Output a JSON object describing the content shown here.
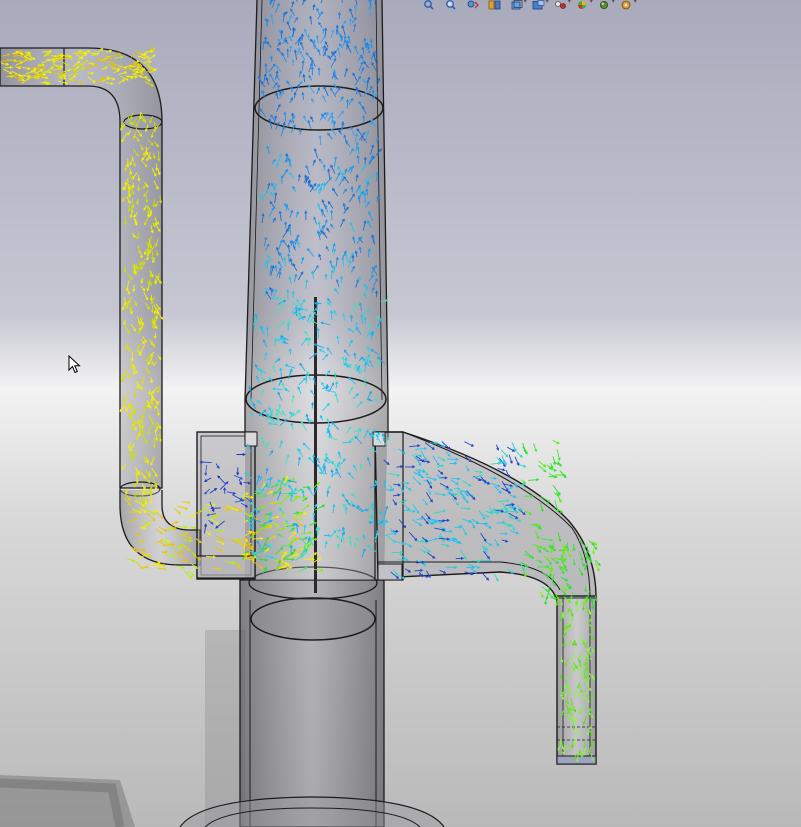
{
  "app": {
    "view": "flow-simulation-viewport"
  },
  "toolbar": {
    "items": [
      {
        "icon": "zoom-to-fit-icon",
        "has_menu": false
      },
      {
        "icon": "zoom-to-area-icon",
        "has_menu": false
      },
      {
        "icon": "previous-view-icon",
        "has_menu": false
      },
      {
        "icon": "section-view-icon",
        "has_menu": false
      },
      {
        "icon": "view-orientation-icon",
        "has_menu": true
      },
      {
        "icon": "display-style-icon",
        "has_menu": true
      },
      {
        "icon": "hide-show-items-icon",
        "has_menu": true
      },
      {
        "icon": "edit-appearance-icon",
        "has_menu": true
      },
      {
        "icon": "apply-scene-icon",
        "has_menu": true
      },
      {
        "icon": "view-settings-icon",
        "has_menu": true
      }
    ]
  },
  "colors": {
    "background_top": "#aeb0c2",
    "background_horizon": "#f2f2f2",
    "background_bottom": "#bdbdbd",
    "pipe_fill": "#9a9a9e",
    "pipe_edge": "#1c1c1c",
    "vectors_high": "#f2f000",
    "vectors_mid": "#2be02b",
    "vectors_low": "#1fc2f0",
    "vectors_lowest": "#2244cc"
  }
}
